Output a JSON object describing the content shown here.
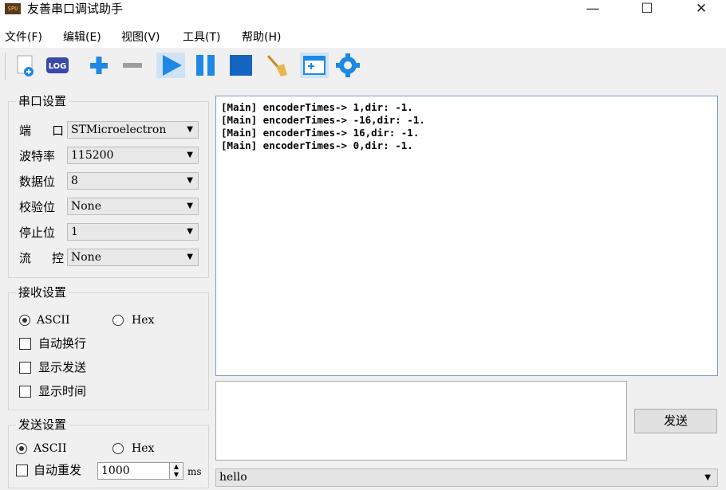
{
  "window": {
    "title": "友善串口调试助手",
    "icon_text": "SPU"
  },
  "menu": [
    "文件(F)",
    "编辑(E)",
    "视图(V)",
    "工具(T)",
    "帮助(H)"
  ],
  "toolbar": {
    "log_label": "LOG"
  },
  "serial_settings": {
    "title": "串口设置",
    "port_label": "端 口",
    "port_value": "STMicroelectron",
    "baud_label": "波特率",
    "baud_value": "115200",
    "databits_label": "数据位",
    "databits_value": "8",
    "parity_label": "校验位",
    "parity_value": "None",
    "stopbits_label": "停止位",
    "stopbits_value": "1",
    "flow_label": "流 控",
    "flow_value": "None"
  },
  "receive_settings": {
    "title": "接收设置",
    "ascii_label": "ASCII",
    "hex_label": "Hex",
    "ascii_checked": true,
    "auto_wrap_label": "自动换行",
    "show_send_label": "显示发送",
    "show_time_label": "显示时间"
  },
  "send_settings": {
    "title": "发送设置",
    "ascii_label": "ASCII",
    "hex_label": "Hex",
    "ascii_checked": true,
    "auto_resend_label": "自动重发",
    "interval_value": "1000",
    "interval_unit": "ms"
  },
  "receive_log": [
    "[Main] encoderTimes-> 1,dir: -1.",
    "[Main] encoderTimes-> -16,dir: -1.",
    "[Main] encoderTimes-> 16,dir: -1.",
    "[Main] encoderTimes-> 0,dir: -1."
  ],
  "send_button_label": "发送",
  "history_value": "hello",
  "colors": {
    "accent_blue": "#1e88e5",
    "border_blue": "#7a9cc6"
  }
}
